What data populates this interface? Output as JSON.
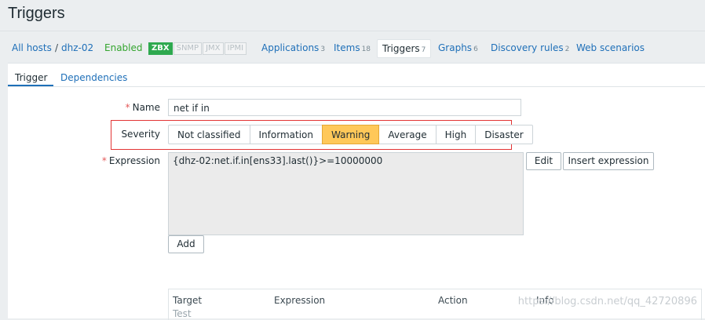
{
  "page": {
    "title": "Triggers"
  },
  "hostnav": {
    "all_hosts": "All hosts",
    "sep": "/",
    "host": "dhz-02",
    "status": "Enabled",
    "badges": {
      "zbx": "ZBX",
      "snmp": "SNMP",
      "jmx": "JMX",
      "ipmi": "IPMI"
    },
    "applications": {
      "label": "Applications",
      "count": "3"
    },
    "items": {
      "label": "Items",
      "count": "18"
    },
    "triggers": {
      "label": "Triggers",
      "count": "7"
    },
    "graphs": {
      "label": "Graphs",
      "count": "6"
    },
    "discovery": {
      "label": "Discovery rules",
      "count": "2"
    },
    "web": {
      "label": "Web scenarios"
    }
  },
  "form": {
    "tabs": {
      "trigger": "Trigger",
      "dependencies": "Dependencies"
    },
    "name_label": "Name",
    "required_mark": "*",
    "name_value": "net if in",
    "severity_label": "Severity",
    "severity": {
      "options": [
        "Not classified",
        "Information",
        "Warning",
        "Average",
        "High",
        "Disaster"
      ],
      "selected": "Warning",
      "selected_color": "#ffc859"
    },
    "expression_label": "Expression",
    "expression_value": "{dhz-02:net.if.in[ens33].last()}>=10000000",
    "edit_button": "Edit",
    "insert_button": "Insert expression",
    "add_button": "Add",
    "table": {
      "headers": [
        "Target",
        "Expression",
        "Action",
        "Info"
      ],
      "first_row": "Test"
    }
  },
  "watermark": "https://blog.csdn.net/qq_42720896"
}
